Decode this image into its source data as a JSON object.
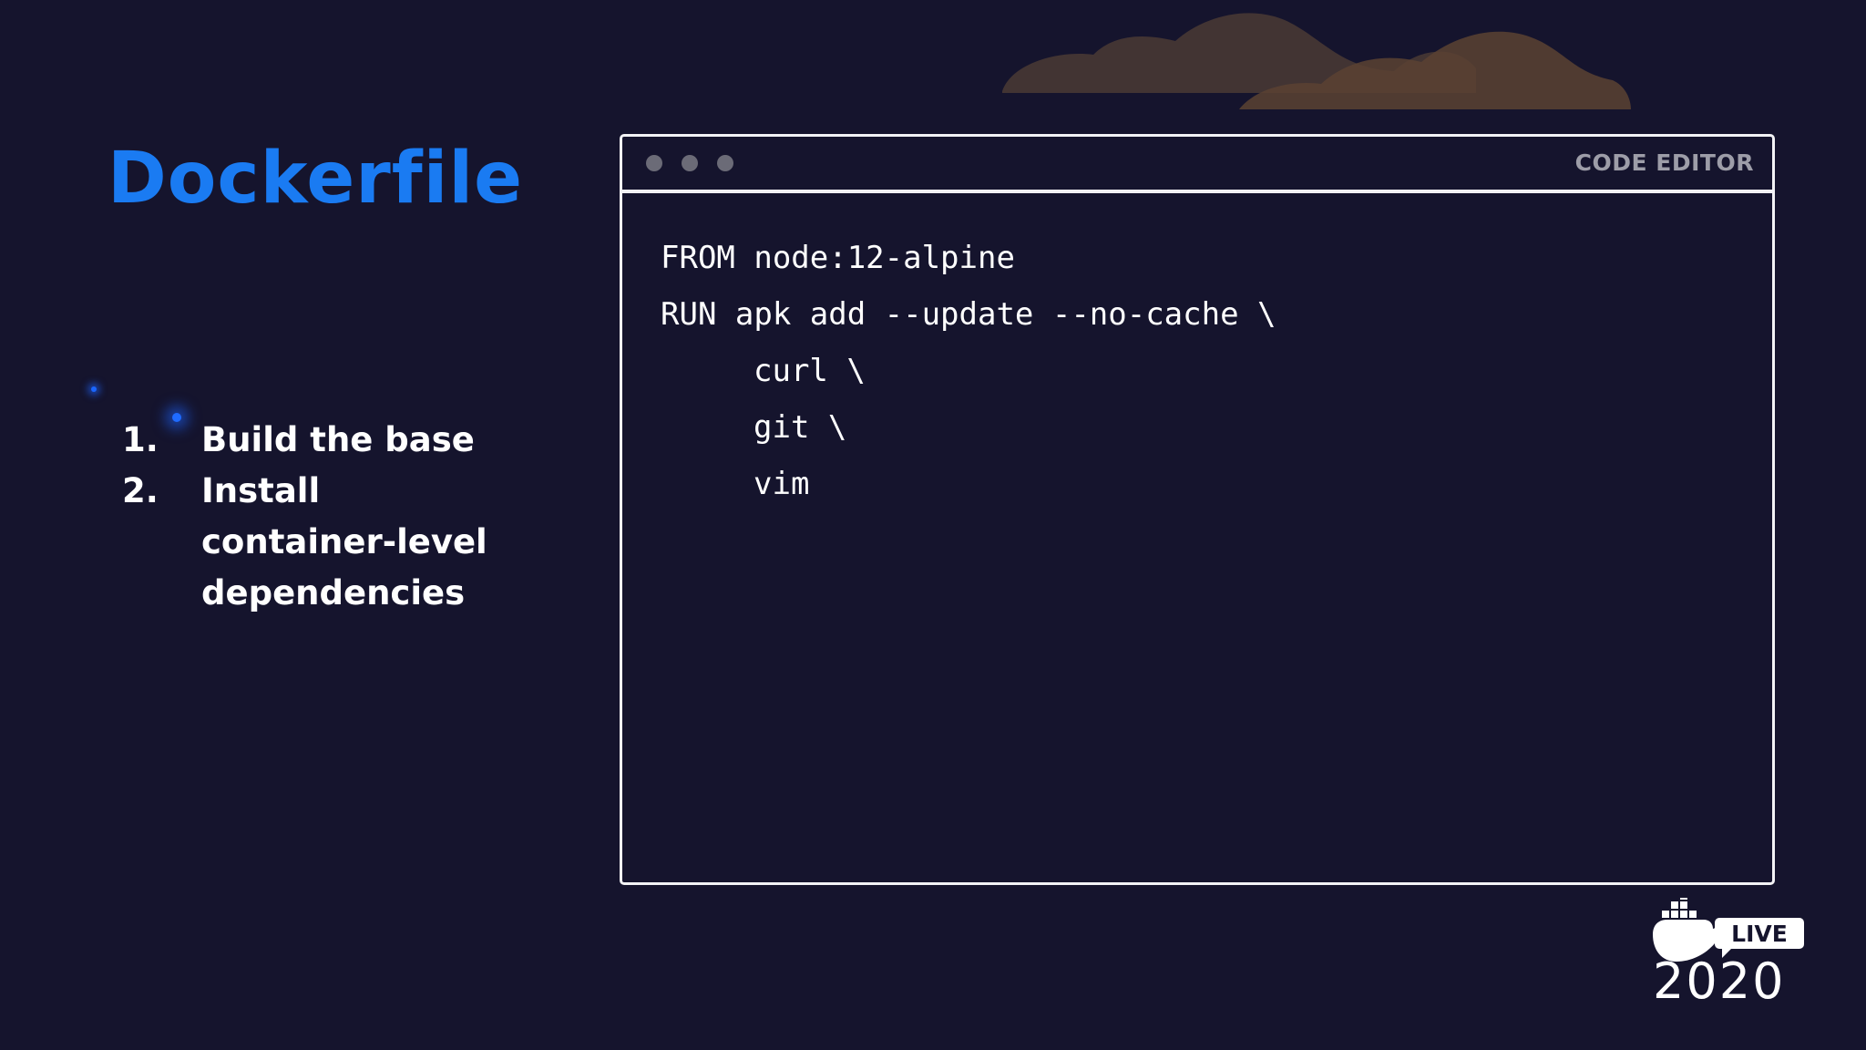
{
  "slide": {
    "title": "Dockerfile",
    "steps": [
      {
        "number": "1.",
        "text": "Build the base"
      },
      {
        "number": "2.",
        "text": "Install container-level dependencies"
      }
    ]
  },
  "editor": {
    "label": "CODE EDITOR",
    "lines": [
      "FROM node:12-alpine",
      "RUN apk add --update --no-cache \\",
      "curl \\",
      "git \\",
      "vim"
    ]
  },
  "logo": {
    "badge": "LIVE",
    "year": "2020",
    "icon": "docker-whale-icon"
  },
  "colors": {
    "background": "#15142d",
    "title": "#1a7bf2",
    "cloud": "#5a3f2c"
  }
}
